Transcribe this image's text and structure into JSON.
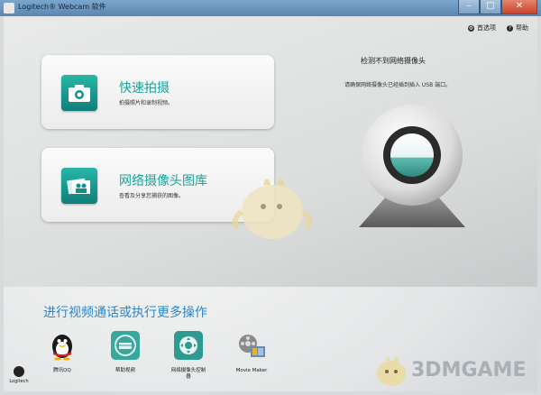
{
  "window": {
    "title": "Logitech® Webcam 软件"
  },
  "toplinks": [
    {
      "label": "首选项",
      "icon": "gear-icon"
    },
    {
      "label": "帮助",
      "icon": "help-icon"
    }
  ],
  "cards": [
    {
      "title": "快速拍摄",
      "desc": "拍摄照片和录制视频。",
      "icon": "camera-icon"
    },
    {
      "title": "网络摄像头图库",
      "desc": "查看及分享您捕获的图像。",
      "icon": "gallery-icon"
    }
  ],
  "status": {
    "title": "检测不到网络摄像头",
    "desc": "请确保网络摄像头已经插到插入 USB 端口。"
  },
  "lower": {
    "title": "进行视频通话或执行更多操作",
    "tools": [
      {
        "label": "腾讯QQ",
        "icon": "qq-penguin-icon"
      },
      {
        "label": "帮助视频",
        "icon": "help-video-icon"
      },
      {
        "label": "网络摄像头控制器",
        "icon": "webcam-controller-icon"
      },
      {
        "label": "Movie Maker",
        "icon": "movie-maker-icon"
      }
    ]
  },
  "logo": {
    "label": "Logitech"
  },
  "watermark": {
    "text": "3DMGAME"
  },
  "colors": {
    "accent": "#18a39a",
    "link": "#2e86c8",
    "titlebar": "#6a96bf"
  }
}
